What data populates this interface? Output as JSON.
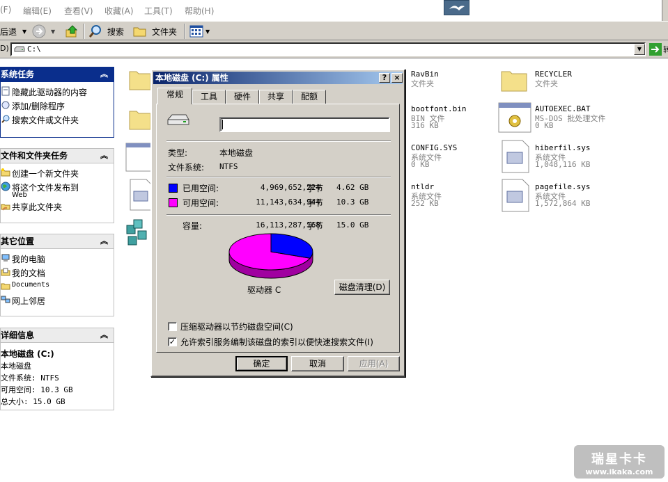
{
  "menu": {
    "file": "(F)",
    "edit": "编辑(E)",
    "view": "查看(V)",
    "favorites": "收藏(A)",
    "tools": "工具(T)",
    "help": "帮助(H)"
  },
  "toolbar": {
    "back_label": "后退",
    "search_label": "搜索",
    "folders_label": "文件夹"
  },
  "address": {
    "prefix": "D)",
    "value": "C:\\",
    "go_label": "转"
  },
  "sidebar": {
    "system_tasks": {
      "title": "系统任务",
      "items": [
        "隐藏此驱动器的内容",
        "添加/删除程序",
        "搜索文件或文件夹"
      ]
    },
    "file_tasks": {
      "title": "文件和文件夹任务",
      "items": [
        "创建一个新文件夹",
        "将这个文件发布到",
        "Web",
        "共享此文件夹"
      ]
    },
    "other_places": {
      "title": "其它位置",
      "items": [
        "我的电脑",
        "我的文档",
        "Documents",
        "网上邻居"
      ]
    },
    "details": {
      "title": "详细信息",
      "name": "本地磁盘 (C:)",
      "type": "本地磁盘",
      "fs": "文件系统: NTFS",
      "free": "可用空间: 10.3 GB",
      "total": "总大小: 15.0 GB"
    }
  },
  "files": [
    {
      "name": "RavBin",
      "type": "文件夹",
      "size": ""
    },
    {
      "name": "RECYCLER",
      "type": "文件夹",
      "size": ""
    },
    {
      "name": "bootfont.bin",
      "type": "BIN 文件",
      "size": "316 KB"
    },
    {
      "name": "AUTOEXEC.BAT",
      "type": "MS-DOS 批处理文件",
      "size": "0 KB"
    },
    {
      "name": "CONFIG.SYS",
      "type": "系统文件",
      "size": "0 KB"
    },
    {
      "name": "hiberfil.sys",
      "type": "系统文件",
      "size": "1,048,116 KB"
    },
    {
      "name": "ntldr",
      "type": "系统文件",
      "size": "252 KB"
    },
    {
      "name": "pagefile.sys",
      "type": "系统文件",
      "size": "1,572,864 KB"
    }
  ],
  "dialog": {
    "title": "本地磁盘 (C:) 属性",
    "help_btn": "?",
    "close_btn": "×",
    "tabs": [
      "常规",
      "工具",
      "硬件",
      "共享",
      "配额"
    ],
    "volume_label_value": "",
    "type_label": "类型:",
    "type_value": "本地磁盘",
    "fs_label": "文件系统:",
    "fs_value": "NTFS",
    "used_label": "已用空间:",
    "used_bytes": "4,969,652,224",
    "used_unit": "字节",
    "used_gb": "4.62 GB",
    "free_label": "可用空间:",
    "free_bytes": "11,143,634,944",
    "free_unit": "字节",
    "free_gb": "10.3 GB",
    "capacity_label": "容量:",
    "capacity_bytes": "16,113,287,168",
    "capacity_unit": "字节",
    "capacity_gb": "15.0 GB",
    "drive_label": "驱动器 C",
    "cleanup_btn": "磁盘清理(D)",
    "compress_label": "压缩驱动器以节约磁盘空间(C)",
    "compress_checked": false,
    "index_label": "允许索引服务编制该磁盘的索引以便快速搜索文件(I)",
    "index_checked": true,
    "ok_btn": "确定",
    "cancel_btn": "取消",
    "apply_btn": "应用(A)",
    "used_fraction": 0.308,
    "used_color": "#0000ff",
    "free_color": "#ff00ff"
  },
  "watermark": {
    "brand": "瑞星卡卡",
    "url": "www.ikaka.com"
  }
}
